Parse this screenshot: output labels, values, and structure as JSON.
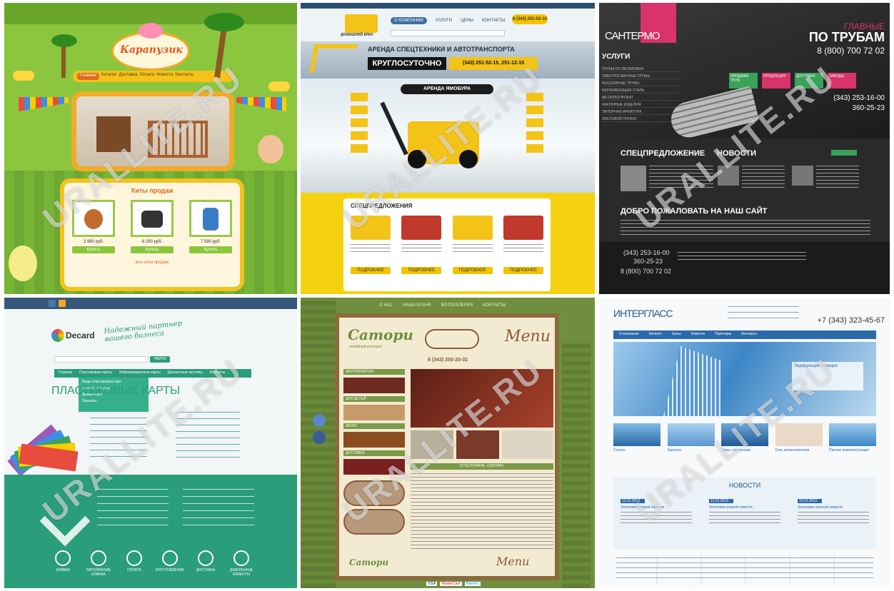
{
  "watermark": "URALLITE.RU",
  "tile1": {
    "logo": "Карапузик",
    "nav": [
      "Главная",
      "Каталог",
      "Доставка",
      "Оплата",
      "Новости",
      "Контакты"
    ],
    "promo_title": "Хиты продаж",
    "prices": [
      "3 990 руб.",
      "8 290 руб.",
      "7 590 руб."
    ],
    "buy": "Купить",
    "footer_link": "все хиты продаж"
  },
  "tile2": {
    "brand": "ДОМАШНИЙ КРАН",
    "nav": [
      "О КОМПАНИИ",
      "УСЛУГИ",
      "ЦЕНЫ",
      "КОНТАКТЫ"
    ],
    "phone_badge": "8 (343) 251-52-15",
    "banner_title": "АРЕНДА СПЕЦТЕХНИКИ И АВТОТРАНСПОРТА",
    "banner_sub": "КРУГЛОСУТОЧНО",
    "banner_phone": "(343) 251-52-15, 251-12-15",
    "hero_label": "АРЕНДА ЯМОБУРА",
    "offers_title": "СПЕЦПРЕДЛОЖЕНИЯ",
    "offer_btn": "ПОДРОБНЕЕ"
  },
  "tile3": {
    "logo": "САНТЕРМО",
    "headline_1": "ГЛАВНЫЕ",
    "headline_2": "ПО ТРУБАМ",
    "phone": "8 (800) 700 72 02",
    "services_title": "УСЛУГИ",
    "services": [
      "ТРУБЫ ПО ЯКОВЛЕВЫХ",
      "ЭЛЕКТРОСВАРНЫЕ ТРУБЫ",
      "БЕСШОВНЫЕ ТРУБЫ",
      "НЕРЖАВЕЮЩАЯ СТАЛЬ",
      "МЕТАЛЛОПРОКАТ",
      "ФАСОННЫЕ ИЗДЕЛИЯ",
      "ЗАПОРНАЯ АРМАТУРА",
      "ЛИСТОВОЙ ПРОКАТ"
    ],
    "tiles": [
      "ПРОДАЖА ТРУБ",
      "ПРОДУКЦИЯ",
      "ДОСТАВКА",
      "ЗАВОДЫ"
    ],
    "phone2a": "(343) 253-16-00",
    "phone2b": "360-25-23",
    "special": "СПЕЦПРЕДЛОЖЕНИЕ",
    "news": "НОВОСТИ",
    "welcome": "ДОБРО ПОЖАЛОВАТЬ НА НАШ САЙТ",
    "footer_phone_a": "(343) 253-16-00",
    "footer_phone_b": "360-25-23",
    "footer_phone_c": "8 (800) 700 72 02"
  },
  "tile4": {
    "logo": "Decard",
    "slogan": "Надежный партнер вашего бизнеса",
    "search_btn": "НАЙТИ",
    "nav": [
      "Главная",
      "Пластиковые карты",
      "Информационные карты",
      "Дисконтные системы",
      "Контакты"
    ],
    "dropdown": [
      "Виды пластиковых карт",
      "Персонализация",
      "Дизайн карт",
      "Заказать"
    ],
    "hero_title": "ПЛАСТИКОВЫЕ КАРТЫ",
    "steps": [
      "ЗАЯВКА",
      "ЗАПОЛНЕНИЕ БЛАНКА",
      "ОПЛАТА",
      "ИЗГОТОВЛЕНИЕ",
      "ДОСТАВКА",
      "ДОВОЛЬНЫЕ КЛИЕНТЫ"
    ]
  },
  "tile5": {
    "nav": [
      "О НАС",
      "НАША КУХНЯ",
      "ФОТОГАЛЕРЕЯ",
      "КОНТАКТЫ"
    ],
    "logo": "Сатори",
    "logo_sub": "семейный ресторан",
    "menu_script": "Menu",
    "phone": "8 (343) 200-20-02",
    "sidebar": [
      "МЕРОПРИЯТИЯ",
      "ДЛЯ ДЕТЕЙ",
      "МЕНЮ",
      "ДОСТАВКА"
    ],
    "content_title": "О РЕСТОРАНЕ «САТОРИ»",
    "cards_pay": [
      "VISA",
      "MasterCard",
      "Maestro"
    ]
  },
  "tile6": {
    "logo": "ИНТЕРГЛАСС",
    "phone": "+7 (343) 323-45-67",
    "nav": [
      "О компании",
      "Каталог",
      "Цены",
      "Новости",
      "Партнеры",
      "Контакты"
    ],
    "hero_caption": "Лидирующие позиции",
    "products": [
      "Стекло",
      "Зеркала",
      "Ткань стеклянная",
      "Сеть металлическая",
      "Прочие комплектующие"
    ],
    "news_title": "НОВОСТИ",
    "news_items": [
      "Заголовок первой новости",
      "Заголовок второй новости",
      "Заголовок третьей новости"
    ],
    "news_date": "12.01.2013"
  }
}
